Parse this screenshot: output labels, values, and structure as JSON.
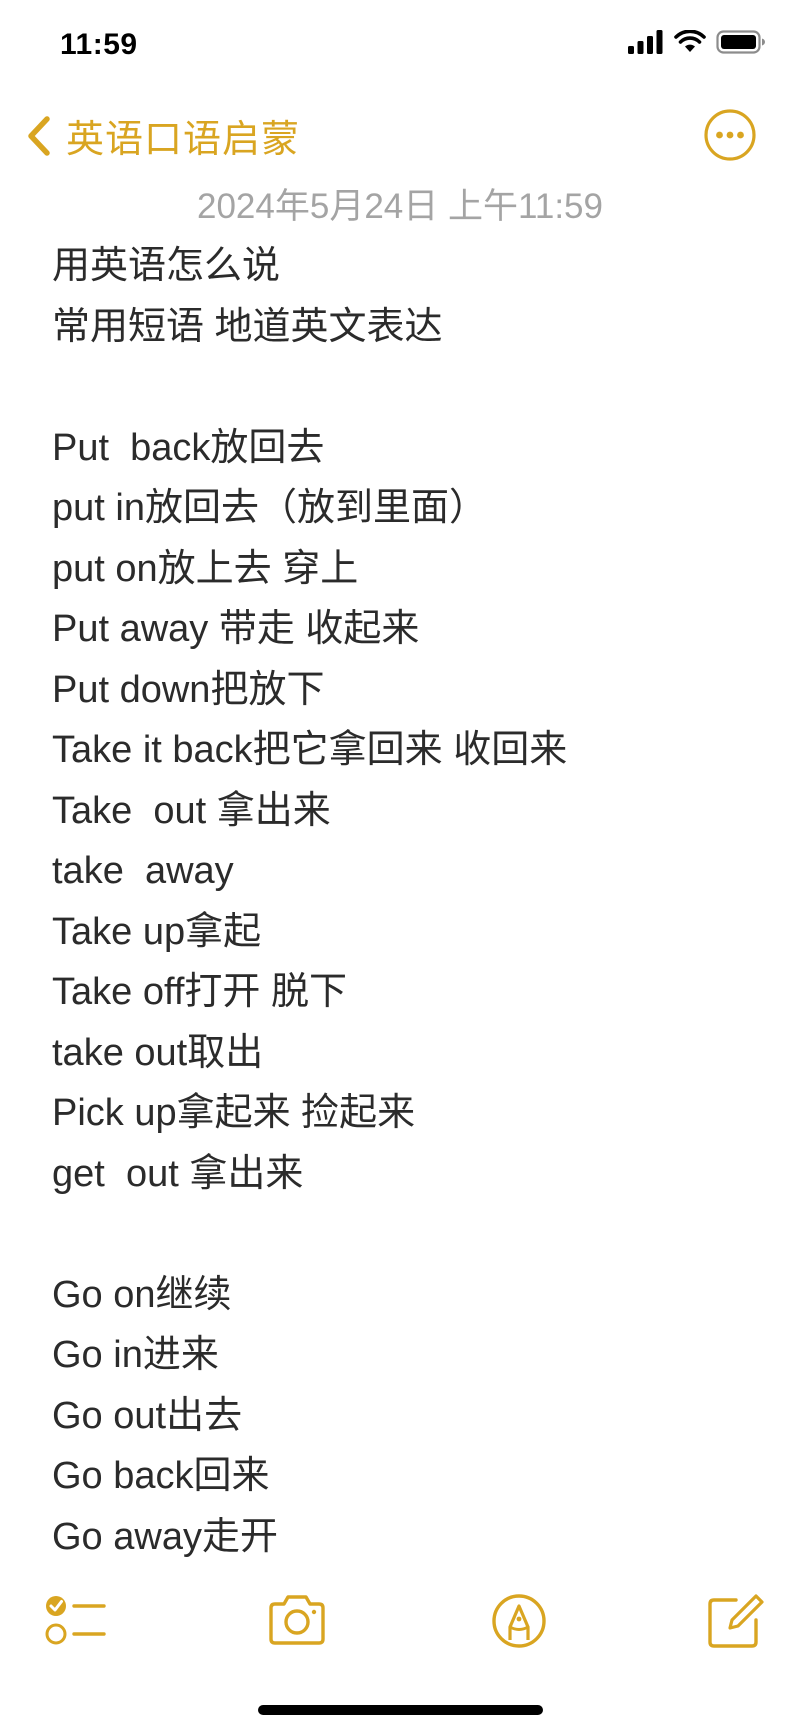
{
  "status_bar": {
    "time": "11:59"
  },
  "nav": {
    "back_label": "英语口语启蒙"
  },
  "note": {
    "date": "2024年5月24日 上午11:59",
    "lines": [
      "用英语怎么说",
      "常用短语 地道英文表达",
      "",
      "Put  back放回去",
      "put in放回去（放到里面）",
      "put on放上去 穿上",
      "Put away 带走 收起来",
      "Put down把放下",
      "Take it back把它拿回来 收回来",
      "Take  out 拿出来",
      "take  away",
      "Take up拿起",
      "Take off打开 脱下",
      "take out取出",
      "Pick up拿起来 捡起来",
      "get  out 拿出来",
      "",
      "Go on继续",
      "Go in进来",
      "Go out出去",
      "Go back回来",
      "Go away走开"
    ]
  },
  "colors": {
    "accent": "#D9A521",
    "text": "#2b2b2b",
    "date": "#a4a4a4"
  },
  "icons": {
    "back": "chevron-left-icon",
    "more": "ellipsis-circle-icon",
    "checklist": "checklist-icon",
    "camera": "camera-icon",
    "markup": "pen-tip-circle-icon",
    "compose": "compose-icon"
  }
}
